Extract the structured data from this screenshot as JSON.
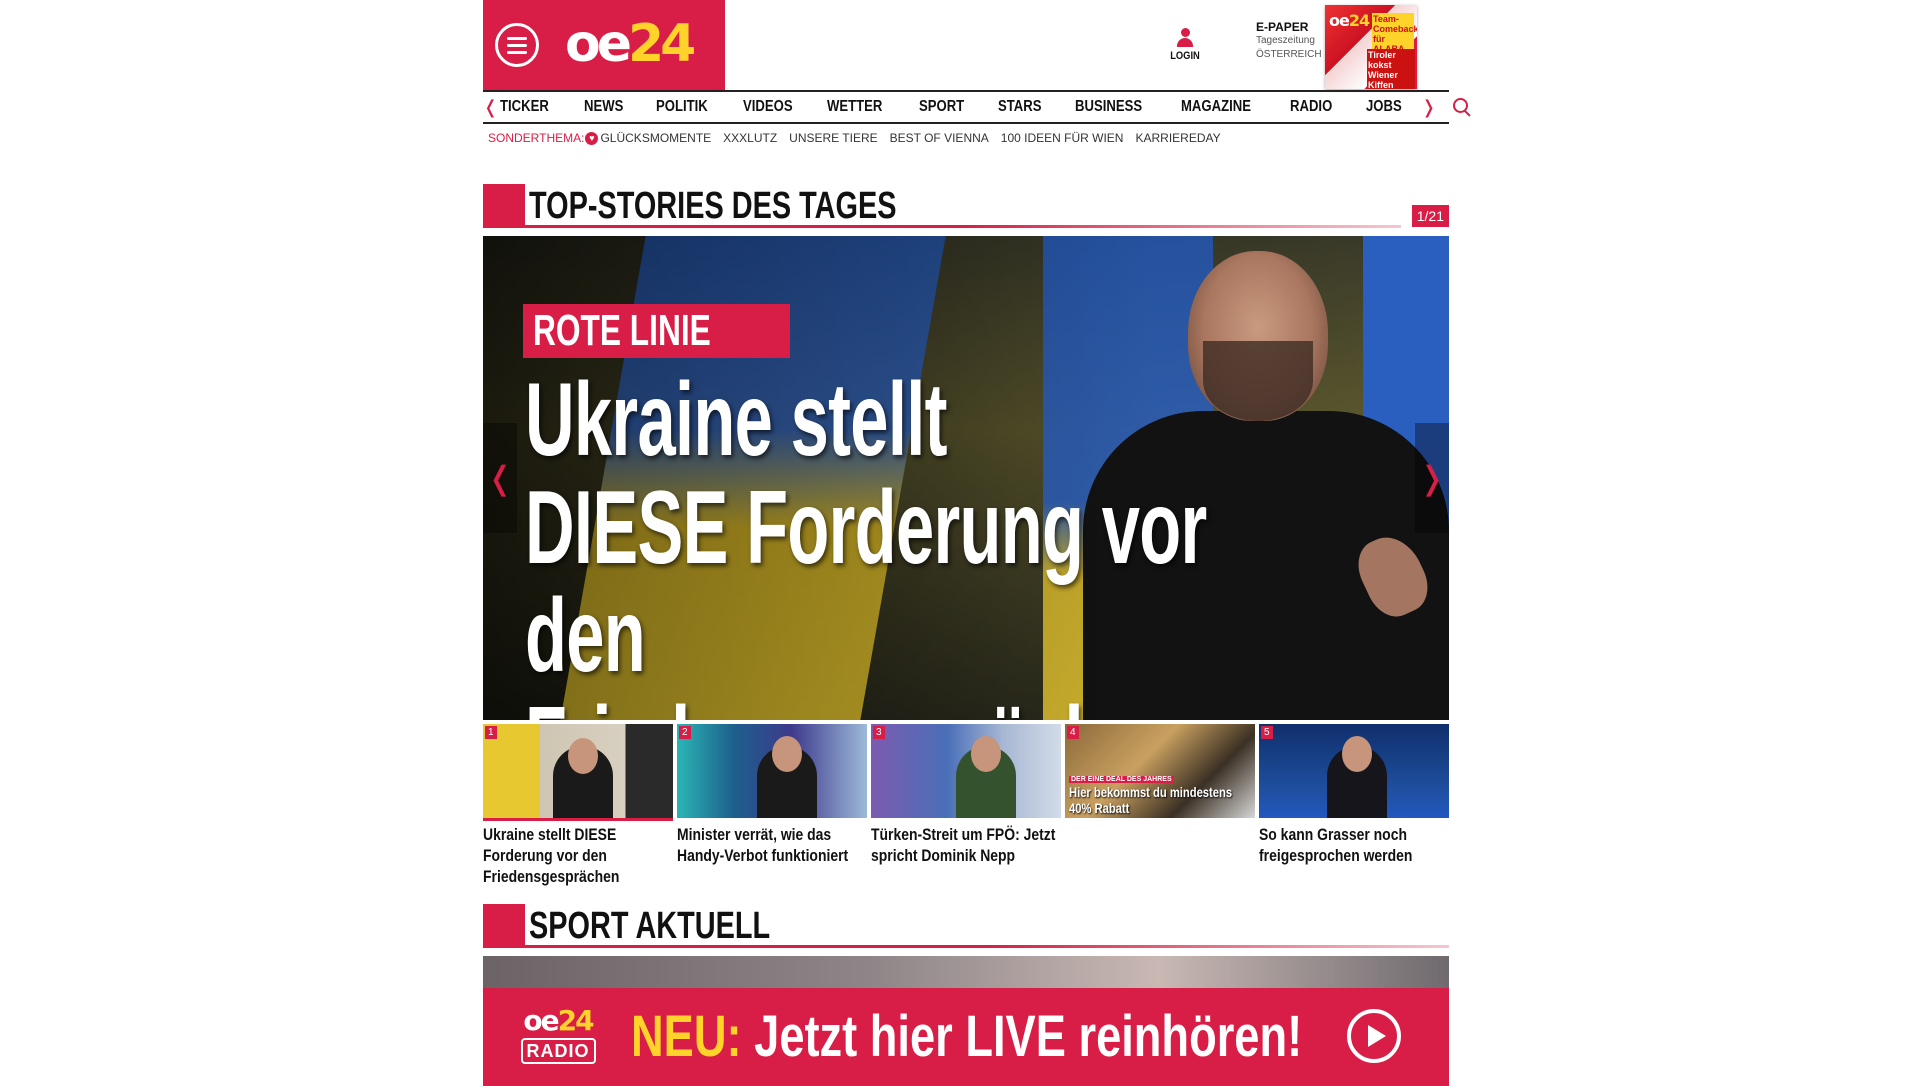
{
  "header": {
    "logo_white": "oe",
    "logo_yellow": "24",
    "login_label": "LOGIN",
    "epaper": {
      "title": "E-PAPER",
      "subtitle": "Tageszeitung",
      "region": "ÖSTERREICH",
      "cover_logo_white": "oe",
      "cover_logo_yellow": "24",
      "cover_headline": "Team-Comeback für ALABA",
      "cover_sub": "Tiroler kokst Wiener Kiffen"
    }
  },
  "nav": {
    "items": [
      "TICKER",
      "NEWS",
      "POLITIK",
      "VIDEOS",
      "WETTER",
      "SPORT",
      "STARS",
      "BUSINESS",
      "MAGAZINE",
      "RADIO",
      "JOBS"
    ],
    "left_arrow": "❬",
    "right_arrow": "❭"
  },
  "subnav": {
    "label": "SONDERTHEMA:",
    "links": [
      "GLÜCKSMOMENTE",
      "XXXLUTZ",
      "UNSERE TIERE",
      "BEST OF VIENNA",
      "100 IDEEN FÜR WIEN",
      "KARRIEREDAY"
    ]
  },
  "top_stories": {
    "title": "TOP-STORIES DES TAGES",
    "pager": "1/21",
    "hero": {
      "kicker": "ROTE LINIE",
      "headline_line1": "Ukraine stellt",
      "headline_line2": "DIESE Forderung vor",
      "headline_line3": "den Friedensgesprächen"
    },
    "thumbs": [
      {
        "num": "1",
        "caption": "Ukraine stellt DIESE Forderung vor den Friedensgesprächen"
      },
      {
        "num": "2",
        "caption": "Minister verrät, wie das Handy-Verbot funktioniert"
      },
      {
        "num": "3",
        "caption": "Türken-Streit um FPÖ: Jetzt spricht Dominik Nepp"
      },
      {
        "num": "4",
        "caption": "",
        "overlay_kicker": "DER EINE DEAL DES JAHRES",
        "overlay_text": "Hier bekommst du mindestens 40% Rabatt"
      },
      {
        "num": "5",
        "caption": "So kann Grasser noch freigesprochen werden"
      }
    ]
  },
  "sport": {
    "title": "SPORT AKTUELL"
  },
  "radio_banner": {
    "logo_white": "oe",
    "logo_yellow": "24",
    "logo_sub": "RADIO",
    "highlight": "NEU:",
    "text": " Jetzt hier LIVE reinhören!"
  },
  "colors": {
    "brand_red": "#d81e46",
    "brand_yellow": "#ffd32a"
  }
}
